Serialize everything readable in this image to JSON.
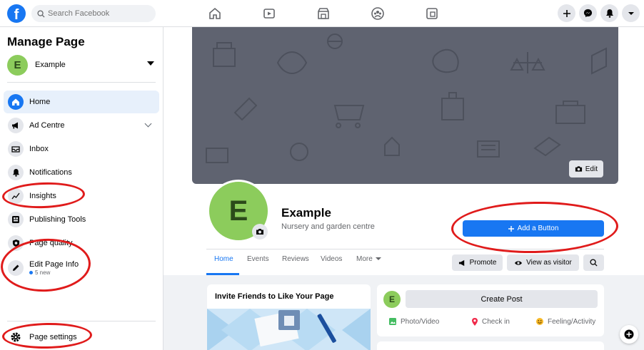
{
  "topbar": {
    "logo": "f",
    "search_placeholder": "Search Facebook",
    "nav_icons": [
      "home-icon",
      "watch-icon",
      "marketplace-icon",
      "groups-icon",
      "gaming-icon"
    ],
    "right_icons": [
      "plus-icon",
      "messenger-icon",
      "notifications-icon",
      "account-caret-icon"
    ]
  },
  "sidebar": {
    "title": "Manage Page",
    "page": {
      "initial": "E",
      "name": "Example"
    },
    "items": [
      {
        "label": "Home",
        "icon": "home-icon",
        "active": true
      },
      {
        "label": "Ad Centre",
        "icon": "megaphone-icon"
      },
      {
        "label": "Inbox",
        "icon": "inbox-icon"
      },
      {
        "label": "Notifications",
        "icon": "bell-icon"
      },
      {
        "label": "Insights",
        "icon": "insights-icon"
      },
      {
        "label": "Publishing Tools",
        "icon": "publishing-tools-icon"
      },
      {
        "label": "Page quality",
        "icon": "shield-icon"
      },
      {
        "label": "Edit Page Info",
        "icon": "pencil-icon",
        "sub": "5 new"
      }
    ],
    "settings_label": "Page settings"
  },
  "profile": {
    "cover_edit": "Edit",
    "initial": "E",
    "name": "Example",
    "category": "Nursery and garden centre",
    "add_button": "Add a Button",
    "tabs": [
      "Home",
      "Events",
      "Reviews",
      "Videos",
      "More"
    ],
    "promote": "Promote",
    "view_as_visitor": "View as visitor"
  },
  "feed": {
    "invite_title": "Invite Friends to Like Your Page",
    "create_post": "Create Post",
    "post_options": [
      "Photo/Video",
      "Check in",
      "Feeling/Activity"
    ]
  },
  "colors": {
    "brand": "#1877f2",
    "annotation": "#e01b1b",
    "avatar": "#8ccc5c"
  }
}
